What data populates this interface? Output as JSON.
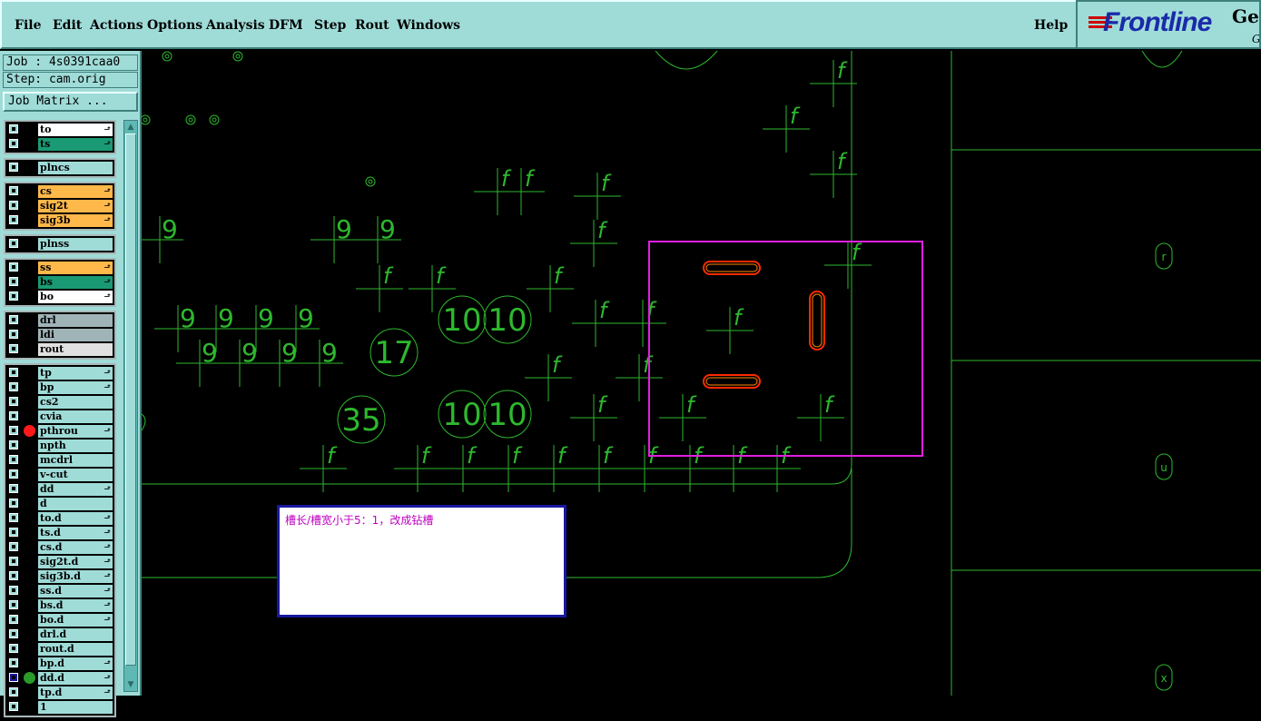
{
  "menu": {
    "items": [
      "File",
      "Edit",
      "Actions",
      "Options",
      "Analysis",
      "DFM",
      "Step",
      "Rout",
      "Windows"
    ],
    "help": "Help"
  },
  "logo": {
    "brand": "Frontline",
    "ge": "Ge",
    "sub": "G"
  },
  "job": {
    "job_label": "Job : 4s0391caa0",
    "step_label": "Step: cam.orig",
    "matrix_button": "Job Matrix ..."
  },
  "layer_groups": [
    [
      {
        "name": "to",
        "color": "#ffffff",
        "arrow": true
      },
      {
        "name": "ts",
        "color": "#1a9a74",
        "arrow": true
      }
    ],
    [
      {
        "name": "plncs",
        "color": "#9fdcd8",
        "arrow": false
      }
    ],
    [
      {
        "name": "cs",
        "color": "#ffb84a",
        "arrow": true
      },
      {
        "name": "sig2t",
        "color": "#ffb84a",
        "arrow": true
      },
      {
        "name": "sig3b",
        "color": "#ffb84a",
        "arrow": true
      }
    ],
    [
      {
        "name": "plnss",
        "color": "#9fdcd8",
        "arrow": false
      }
    ],
    [
      {
        "name": "ss",
        "color": "#ffb84a",
        "arrow": true
      },
      {
        "name": "bs",
        "color": "#1a9a74",
        "arrow": true
      },
      {
        "name": "bo",
        "color": "#ffffff",
        "arrow": true
      }
    ],
    [
      {
        "name": "drl",
        "color": "#a0b4b8",
        "arrow": false
      },
      {
        "name": "ldi",
        "color": "#a0b4b8",
        "arrow": false
      },
      {
        "name": "rout",
        "color": "#e0e0e0",
        "arrow": false
      }
    ],
    [
      {
        "name": "tp",
        "color": "#9fdcd8",
        "arrow": true
      },
      {
        "name": "bp",
        "color": "#9fdcd8",
        "arrow": true
      },
      {
        "name": "cs2",
        "color": "#9fdcd8",
        "arrow": false
      },
      {
        "name": "cvia",
        "color": "#9fdcd8",
        "arrow": false
      },
      {
        "name": "pthrou",
        "color": "#9fdcd8",
        "arrow": true,
        "dot": "#ff1a1a"
      },
      {
        "name": "npth",
        "color": "#9fdcd8",
        "arrow": false
      },
      {
        "name": "mcdrl",
        "color": "#9fdcd8",
        "arrow": false
      },
      {
        "name": "v-cut",
        "color": "#9fdcd8",
        "arrow": false
      },
      {
        "name": "dd",
        "color": "#9fdcd8",
        "arrow": true
      },
      {
        "name": "d",
        "color": "#9fdcd8",
        "arrow": false
      },
      {
        "name": "to.d",
        "color": "#9fdcd8",
        "arrow": true
      },
      {
        "name": "ts.d",
        "color": "#9fdcd8",
        "arrow": true
      },
      {
        "name": "cs.d",
        "color": "#9fdcd8",
        "arrow": true
      },
      {
        "name": "sig2t.d",
        "color": "#9fdcd8",
        "arrow": true
      },
      {
        "name": "sig3b.d",
        "color": "#9fdcd8",
        "arrow": true
      },
      {
        "name": "ss.d",
        "color": "#9fdcd8",
        "arrow": true
      },
      {
        "name": "bs.d",
        "color": "#9fdcd8",
        "arrow": true
      },
      {
        "name": "bo.d",
        "color": "#9fdcd8",
        "arrow": true
      },
      {
        "name": "drl.d",
        "color": "#9fdcd8",
        "arrow": false
      },
      {
        "name": "rout.d",
        "color": "#9fdcd8",
        "arrow": false
      },
      {
        "name": "bp.d",
        "color": "#9fdcd8",
        "arrow": true
      },
      {
        "name": "dd.d",
        "color": "#9fdcd8",
        "arrow": true,
        "dot": "#2a9a2a",
        "selected": true
      },
      {
        "name": "tp.d",
        "color": "#9fdcd8",
        "arrow": true
      },
      {
        "name": "1",
        "color": "#9fdcd8",
        "arrow": false
      }
    ]
  ],
  "canvas": {
    "circle_labels": [
      "10",
      "10",
      "17",
      "35",
      "10",
      "10"
    ],
    "f_label": "f",
    "nine_label": "9",
    "side_markers": [
      "r",
      "u",
      "x"
    ]
  },
  "message": "槽长/槽宽小于5：1，改成钻槽",
  "colors": {
    "panel": "#9fdcd8",
    "drawing_green": "#2eb82e",
    "highlight_box": "#e020e0",
    "slot_red": "#ff2a00",
    "message_text": "#c000c0"
  }
}
